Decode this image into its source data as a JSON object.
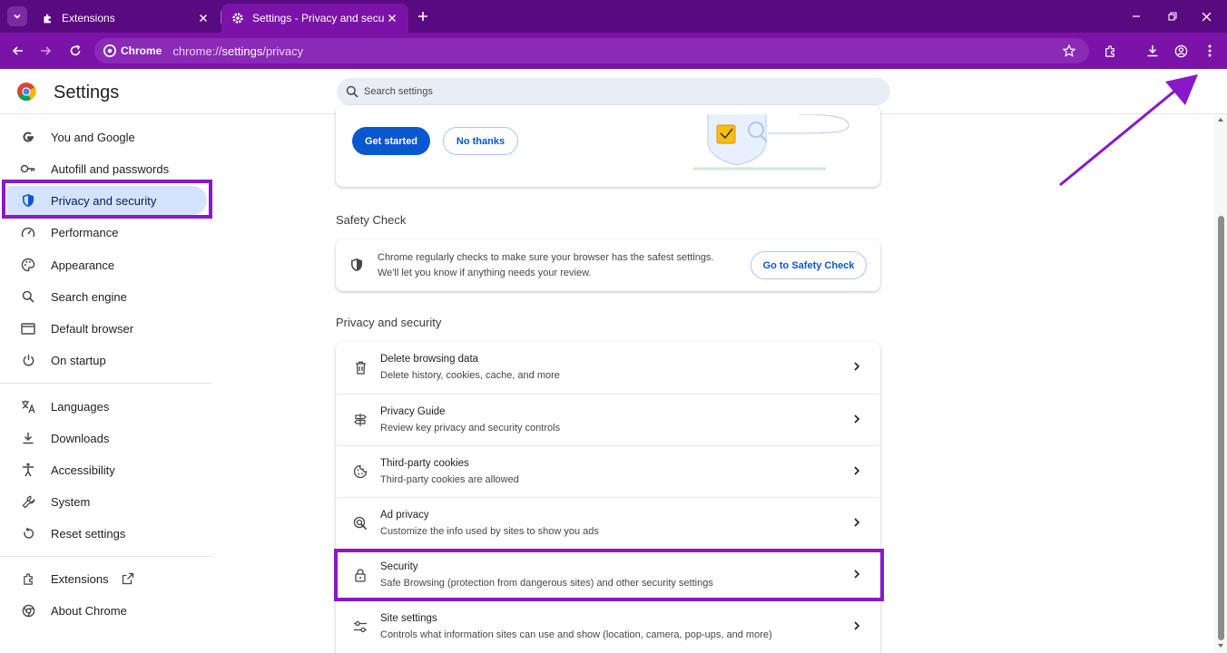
{
  "tabs": [
    {
      "title": "Extensions",
      "active": false
    },
    {
      "title": "Settings - Privacy and security",
      "active": true
    }
  ],
  "omnibox": {
    "chip": "Chrome",
    "url_prefix": "chrome://",
    "url_path": "settings",
    "url_suffix": "/privacy"
  },
  "header": {
    "title": "Settings",
    "search_placeholder": "Search settings"
  },
  "sidebar": {
    "items": [
      {
        "label": "You and Google",
        "icon": "google-g-icon"
      },
      {
        "label": "Autofill and passwords",
        "icon": "key-icon"
      },
      {
        "label": "Privacy and security",
        "icon": "shield-icon",
        "active": true
      },
      {
        "label": "Performance",
        "icon": "speedometer-icon"
      },
      {
        "label": "Appearance",
        "icon": "palette-icon"
      },
      {
        "label": "Search engine",
        "icon": "search-icon"
      },
      {
        "label": "Default browser",
        "icon": "browser-window-icon"
      },
      {
        "label": "On startup",
        "icon": "power-icon"
      },
      {
        "label": "Languages",
        "icon": "translate-icon"
      },
      {
        "label": "Downloads",
        "icon": "download-icon"
      },
      {
        "label": "Accessibility",
        "icon": "accessibility-icon"
      },
      {
        "label": "System",
        "icon": "wrench-icon"
      },
      {
        "label": "Reset settings",
        "icon": "reset-icon"
      },
      {
        "label": "Extensions",
        "icon": "puzzle-icon"
      },
      {
        "label": "About Chrome",
        "icon": "chrome-icon"
      }
    ]
  },
  "promo": {
    "primary_label": "Get started",
    "secondary_label": "No thanks"
  },
  "safety_check": {
    "section_title": "Safety Check",
    "line1": "Chrome regularly checks to make sure your browser has the safest settings.",
    "line2": "We'll let you know if anything needs your review.",
    "button_label": "Go to Safety Check"
  },
  "privacy": {
    "section_title": "Privacy and security",
    "rows": [
      {
        "title": "Delete browsing data",
        "subtitle": "Delete history, cookies, cache, and more",
        "icon": "trash-icon"
      },
      {
        "title": "Privacy Guide",
        "subtitle": "Review key privacy and security controls",
        "icon": "signpost-icon"
      },
      {
        "title": "Third-party cookies",
        "subtitle": "Third-party cookies are allowed",
        "icon": "cookie-icon"
      },
      {
        "title": "Ad privacy",
        "subtitle": "Customize the info used by sites to show you ads",
        "icon": "ad-target-icon"
      },
      {
        "title": "Security",
        "subtitle": "Safe Browsing (protection from dangerous sites) and other security settings",
        "icon": "lock-icon"
      },
      {
        "title": "Site settings",
        "subtitle": "Controls what information sites can use and show (location, camera, pop-ups, and more)",
        "icon": "sliders-icon"
      }
    ]
  },
  "colors": {
    "toolbar": "#7b13a8",
    "tabstrip": "#5a0a80",
    "annotation": "#8a18c9",
    "accent": "#0b57d0"
  }
}
